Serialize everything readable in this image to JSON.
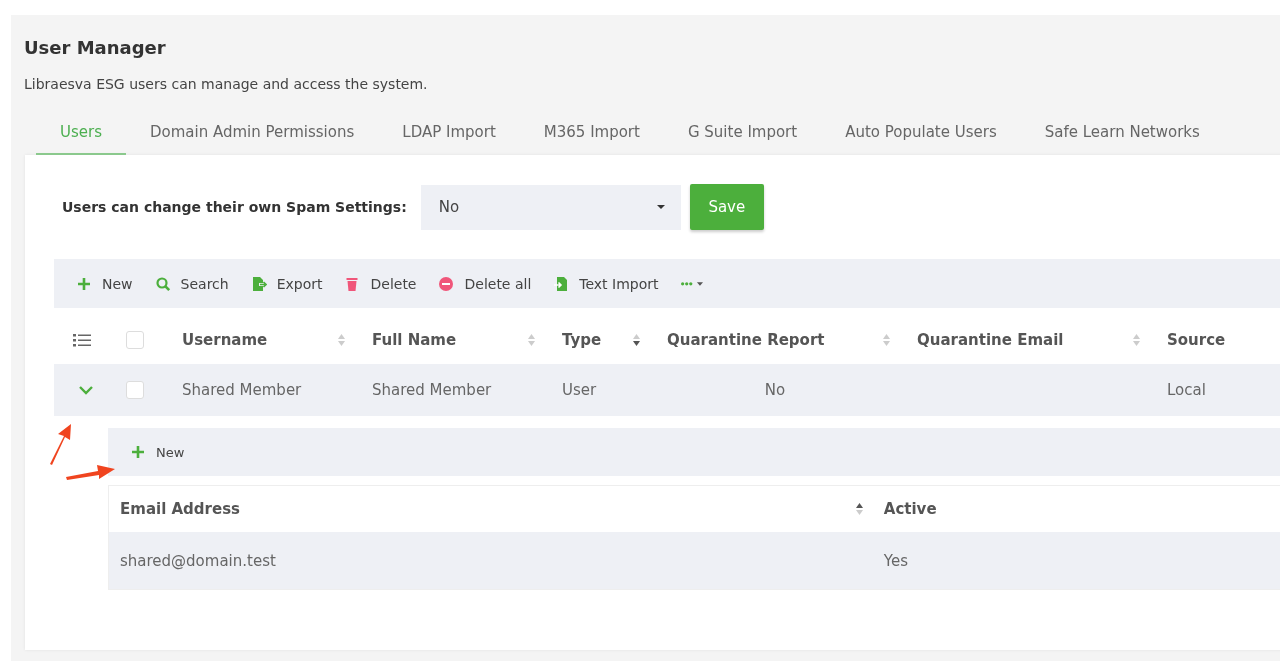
{
  "page": {
    "title": "User Manager",
    "description": "Libraesva ESG users can manage and access the system."
  },
  "tabs": [
    {
      "label": "Users",
      "selected": true
    },
    {
      "label": "Domain Admin Permissions",
      "selected": false
    },
    {
      "label": "LDAP Import",
      "selected": false
    },
    {
      "label": "M365 Import",
      "selected": false
    },
    {
      "label": "G Suite Import",
      "selected": false
    },
    {
      "label": "Auto Populate Users",
      "selected": false
    },
    {
      "label": "Safe Learn Networks",
      "selected": false
    }
  ],
  "setting": {
    "label": "Users can change their own Spam Settings:",
    "value": "No",
    "button": "Save"
  },
  "toolbar": [
    {
      "kind": "button",
      "label": "New"
    },
    {
      "kind": "button",
      "label": "Search"
    },
    {
      "kind": "button",
      "label": "Export"
    },
    {
      "kind": "button",
      "label": "Delete"
    },
    {
      "kind": "button",
      "label": "Delete all"
    },
    {
      "kind": "button",
      "label": "Text Import"
    },
    {
      "kind": "menu"
    }
  ],
  "users_table": {
    "header_checked": false,
    "columns": [
      {
        "label": "Username",
        "sorted_ascending": false,
        "sorted_descending": false
      },
      {
        "label": "Full Name",
        "sorted_ascending": false,
        "sorted_descending": false
      },
      {
        "label": "Type",
        "sorted_ascending": false,
        "sorted_descending": true
      },
      {
        "label": "Quarantine Report",
        "sorted_ascending": false,
        "sorted_descending": false
      },
      {
        "label": "Quarantine Email",
        "sorted_ascending": false,
        "sorted_descending": false
      },
      {
        "label": "Source"
      }
    ],
    "rows": [
      {
        "expanded": true,
        "checked": false,
        "cells": [
          "Shared Member",
          "Shared Member",
          "User",
          "No",
          "",
          "Local"
        ]
      }
    ]
  },
  "row_detail": {
    "toolbar": [
      {
        "kind": "button",
        "label": "New"
      }
    ],
    "columns": [
      {
        "label": "Email Address",
        "sorted_ascending": true,
        "sorted_descending": false
      },
      {
        "label": "Active"
      }
    ],
    "rows": [
      [
        "shared@domain.test",
        "Yes"
      ]
    ]
  }
}
